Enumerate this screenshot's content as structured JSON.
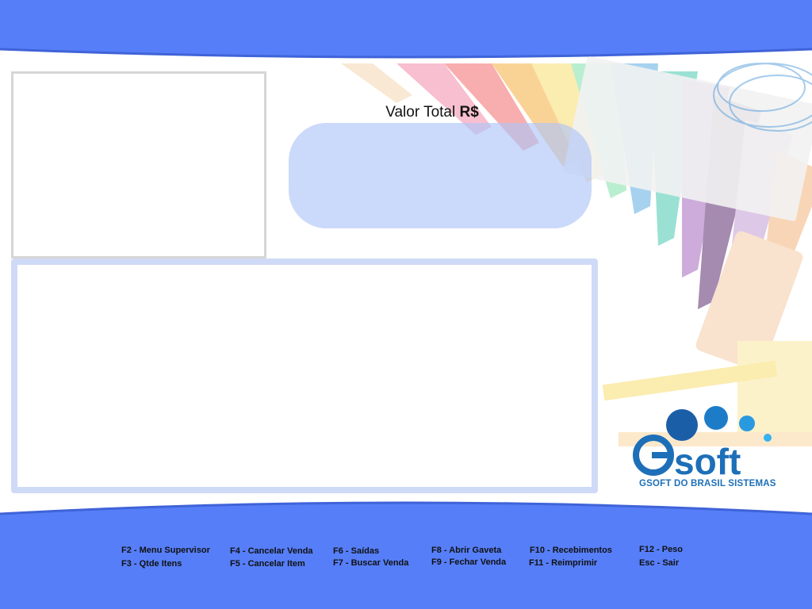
{
  "total": {
    "label": "Valor Total",
    "currency": "R$",
    "value": ""
  },
  "logo": {
    "brand": "soft",
    "letter": "G",
    "subtitle": "GSOFT DO BRASIL SISTEMAS"
  },
  "shortcuts": [
    "F2 - Menu Supervisor",
    "F3 - Qtde Itens",
    "F4 - Cancelar Venda",
    "F5 - Cancelar Item",
    "F6 - Saídas",
    "F7 - Buscar Venda",
    "F8 - Abrir Gaveta",
    "F9 - Fechar Venda",
    "F10 - Recebimentos",
    "F11 - Reimprimir",
    "F12 - Peso",
    "Esc - Sair"
  ],
  "colors": {
    "band": "#567ef8",
    "panel": "#cfdaf7",
    "logo": "#1d6fb8"
  }
}
